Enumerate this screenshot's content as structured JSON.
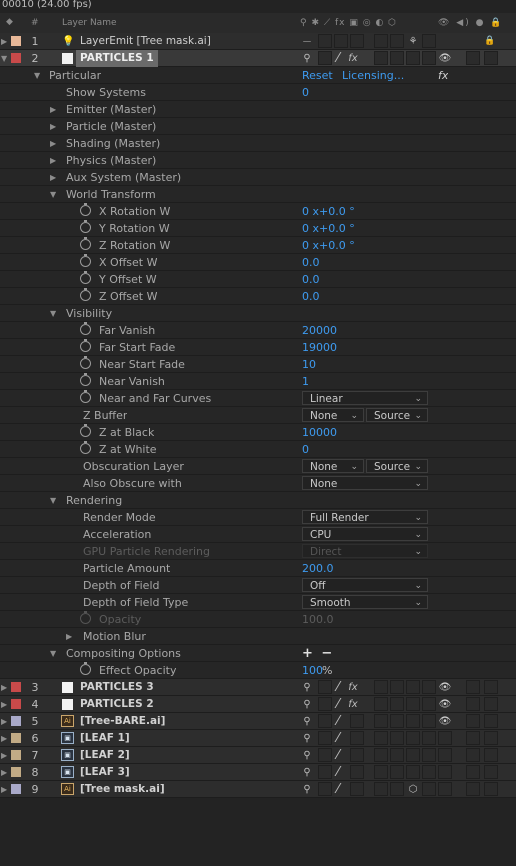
{
  "top": {
    "timecode": "00010 (24.00 fps)"
  },
  "header": {
    "num": "#",
    "layer_name": "Layer Name",
    "switch_icons": "⚲ ✱ ⟋ fx ▣ ◎ ◐ ⬡",
    "av_icons": "👁 ◀) ● 🔒"
  },
  "layers_top": [
    {
      "num": "1",
      "name": "LayerEmit [Tree mask.ai]",
      "color": "#e8b898"
    },
    {
      "num": "2",
      "name": "PARTICLES 1",
      "color": "#c84a4a"
    }
  ],
  "particular": {
    "name": "Particular",
    "reset": "Reset",
    "licensing": "Licensing...",
    "fx": "fx"
  },
  "props": [
    {
      "label": "Show Systems",
      "value": "0"
    },
    {
      "label": "Emitter (Master)"
    },
    {
      "label": "Particle (Master)"
    },
    {
      "label": "Shading (Master)"
    },
    {
      "label": "Physics (Master)"
    },
    {
      "label": "Aux System (Master)"
    },
    {
      "label": "World Transform"
    },
    {
      "label": "X Rotation W",
      "value": "0 x+0.0 °"
    },
    {
      "label": "Y Rotation W",
      "value": "0 x+0.0 °"
    },
    {
      "label": "Z Rotation W",
      "value": "0 x+0.0 °"
    },
    {
      "label": "X Offset W",
      "value": "0.0"
    },
    {
      "label": "Y Offset W",
      "value": "0.0"
    },
    {
      "label": "Z Offset W",
      "value": "0.0"
    },
    {
      "label": "Visibility"
    },
    {
      "label": "Far Vanish",
      "value": "20000"
    },
    {
      "label": "Far Start Fade",
      "value": "19000"
    },
    {
      "label": "Near Start Fade",
      "value": "10"
    },
    {
      "label": "Near Vanish",
      "value": "1"
    },
    {
      "label": "Near and Far Curves",
      "dropdown": "Linear"
    },
    {
      "label": "Z Buffer",
      "dropdown": "None",
      "dropdown2": "Source"
    },
    {
      "label": "Z at Black",
      "value": "10000"
    },
    {
      "label": "Z at White",
      "value": "0"
    },
    {
      "label": "Obscuration Layer",
      "dropdown": "None",
      "dropdown2": "Source"
    },
    {
      "label": "Also Obscure with",
      "dropdown": "None"
    },
    {
      "label": "Rendering"
    },
    {
      "label": "Render Mode",
      "dropdown": "Full Render"
    },
    {
      "label": "Acceleration",
      "dropdown": "CPU"
    },
    {
      "label": "GPU Particle Rendering",
      "dropdown": "Direct"
    },
    {
      "label": "Particle Amount",
      "value": "200.0"
    },
    {
      "label": "Depth of Field",
      "dropdown": "Off"
    },
    {
      "label": "Depth of Field Type",
      "dropdown": "Smooth"
    },
    {
      "label": "Opacity",
      "value": "100.0"
    },
    {
      "label": "Motion Blur"
    },
    {
      "label": "Compositing Options",
      "plusminus": "+ −"
    },
    {
      "label": "Effect Opacity",
      "value": "100",
      "unit": "%"
    }
  ],
  "layers_bottom": [
    {
      "num": "3",
      "name": "PARTICLES 3",
      "color": "#c84a4a"
    },
    {
      "num": "4",
      "name": "PARTICLES 2",
      "color": "#c84a4a"
    },
    {
      "num": "5",
      "name": "[Tree-BARE.ai]",
      "color": "#a9a9c9"
    },
    {
      "num": "6",
      "name": "[LEAF 1]",
      "color": "#c2ab86"
    },
    {
      "num": "7",
      "name": "[LEAF 2]",
      "color": "#c2ab86"
    },
    {
      "num": "8",
      "name": "[LEAF 3]",
      "color": "#c2ab86"
    },
    {
      "num": "9",
      "name": "[Tree mask.ai]",
      "color": "#a9a9c9"
    }
  ],
  "glyphs": {
    "eye": "👁",
    "fx": "fx",
    "slash": "⁄",
    "collapse": "⌄",
    "lock": "🔒",
    "shy": "⚲",
    "ai": "Ai",
    "img": "▣"
  }
}
